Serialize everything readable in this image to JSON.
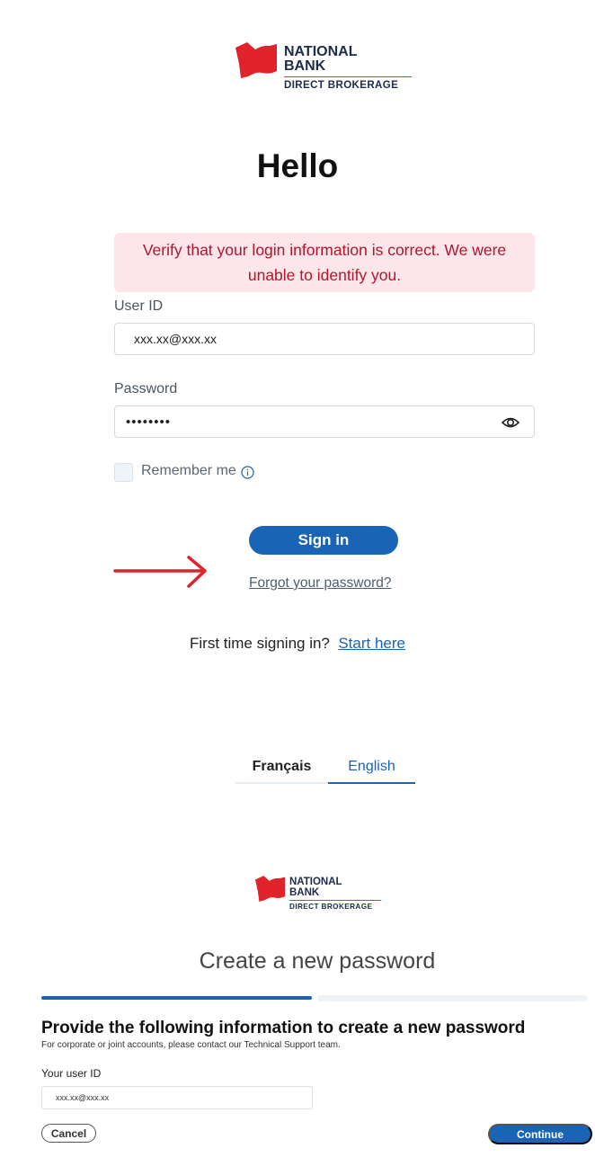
{
  "logo": {
    "brand_line1": "NATIONAL",
    "brand_line2": "BANK",
    "sub": "DIRECT BROKERAGE",
    "flag_color": "#e0222b",
    "text_color": "#1c2c4a"
  },
  "login": {
    "heading": "Hello",
    "error_message": "Verify that your login information is correct. We were unable to identify you.",
    "user_id_label": "User ID",
    "user_id_value": "xxx.xx@xxx.xx",
    "password_label": "Password",
    "password_value": "••••••••",
    "remember_label": "Remember me",
    "sign_in_label": "Sign in",
    "forgot_label": "Forgot your password?",
    "first_time_text": "First time signing in?",
    "start_here_label": "Start here"
  },
  "language": {
    "french": "Français",
    "english": "English",
    "selected": "English"
  },
  "reset": {
    "title": "Create a new password",
    "progress": 0.5,
    "heading": "Provide the following information to create a new password",
    "note": "For corporate or joint accounts, please contact our Technical Support team.",
    "user_id_label": "Your user ID",
    "user_id_value": "xxx.xx@xxx.xx",
    "cancel_label": "Cancel",
    "continue_label": "Continue"
  },
  "icons": {
    "password_toggle": "eye-icon",
    "remember_info": "info-icon",
    "annotation": "red-arrow-icon",
    "logo_mark": "flag-logo-icon"
  },
  "colors": {
    "primary": "#1a64b5",
    "error_bg": "#fce6ea",
    "error_text": "#b3142e",
    "arrow": "#e0222b"
  }
}
